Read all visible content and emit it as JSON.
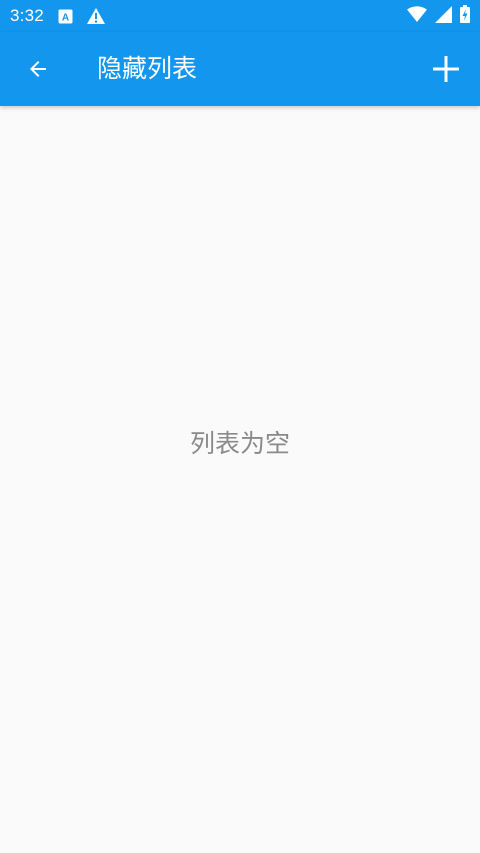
{
  "status_bar": {
    "time": "3:32",
    "icons": [
      "keyboard-a-icon",
      "warning-icon",
      "wifi-icon",
      "cellular-signal-icon",
      "battery-charging-icon"
    ]
  },
  "app_bar": {
    "title": "隐藏列表",
    "back_icon": "arrow-back-icon",
    "add_icon": "plus-icon",
    "color": "#1296ee"
  },
  "content": {
    "empty_message": "列表为空"
  }
}
